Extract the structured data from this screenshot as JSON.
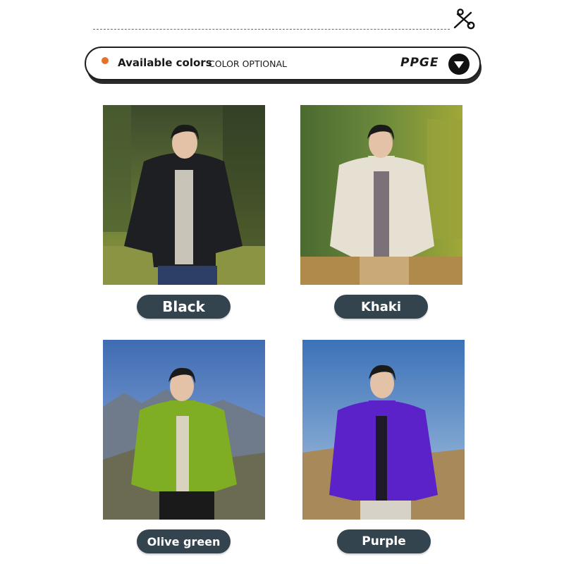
{
  "banner": {
    "title": "Available colors",
    "subtitle": "COLOR OPTIONAL",
    "brand": "PPGE"
  },
  "accent_color": "#e4722a",
  "label_bg_color": "#34444f",
  "icons": [
    "scissors-icon",
    "chevron-down-icon"
  ],
  "colors": [
    {
      "label": "Black",
      "jacket_color": "#1e1f22"
    },
    {
      "label": "Khaki",
      "jacket_color": "#e6e0d2"
    },
    {
      "label": "Olive green",
      "jacket_color": "#7fae24"
    },
    {
      "label": "Purple",
      "jacket_color": "#5a22c8"
    }
  ]
}
